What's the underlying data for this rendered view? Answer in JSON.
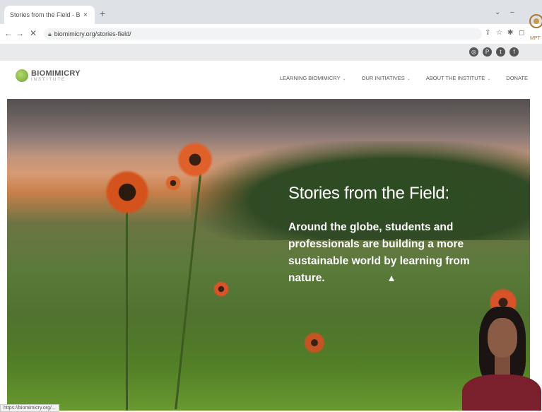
{
  "browser": {
    "tab_title": "Stories from the Field - Biomim",
    "tab_close": "×",
    "new_tab": "+",
    "url": "biomimicry.org/stories-field/",
    "nav": {
      "back": "←",
      "forward": "→",
      "reload": "✕"
    },
    "window_controls": {
      "menu": "⌄",
      "minimize": "–"
    },
    "address_icons": {
      "share": "⇪",
      "bookmark": "☆",
      "extensions": "✱",
      "split": "◻"
    },
    "social_icons": [
      "instagram-icon",
      "pinterest-icon",
      "twitter-icon",
      "facebook-icon"
    ],
    "corner_logo_text": "MPT"
  },
  "site": {
    "logo_main": "BIOMIMICRY",
    "logo_sub": "INSTITUTE",
    "menu": [
      {
        "label": "LEARNING BIOMIMICRY",
        "dropdown": true
      },
      {
        "label": "OUR INITIATIVES",
        "dropdown": true
      },
      {
        "label": "ABOUT THE INSTITUTE",
        "dropdown": true
      },
      {
        "label": "DONATE",
        "dropdown": false
      }
    ],
    "chevron": "⌄"
  },
  "hero": {
    "title": "Stories from the Field:",
    "body": "Around the globe, students and professionals are building a more sustainable world by learning from nature."
  },
  "status_bar": "https://biomimicry.org/...",
  "colors": {
    "accent_green": "#6aa338",
    "menu_text": "#555555",
    "hero_text": "#ffffff"
  }
}
